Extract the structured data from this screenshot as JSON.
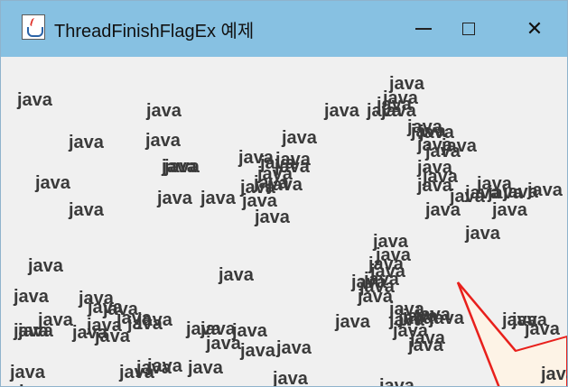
{
  "window": {
    "title": "ThreadFinishFlagEx 예제",
    "icon": "java-coffee-cup-icon",
    "controls": {
      "minimize": "minimize-icon",
      "maximize": "maximize-icon",
      "close": "close-icon"
    }
  },
  "content": {
    "word": "java",
    "labels": [
      "java",
      "java",
      "java",
      "java",
      "java",
      "java",
      "java",
      "java",
      "java",
      "java",
      "java",
      "java",
      "java",
      "java",
      "java",
      "java",
      "java",
      "java",
      "java",
      "java",
      "java",
      "java",
      "java",
      "java",
      "java",
      "java",
      "java",
      "java",
      "java",
      "java",
      "java",
      "java",
      "java",
      "java",
      "java",
      "java",
      "java",
      "java",
      "java",
      "java",
      "java",
      "java",
      "java",
      "java",
      "java",
      "java",
      "java",
      "java",
      "java",
      "java",
      "java",
      "java",
      "java",
      "java",
      "java",
      "java",
      "java",
      "java",
      "java",
      "java",
      "java",
      "java",
      "java",
      "java",
      "java",
      "java",
      "java",
      "java",
      "java",
      "java",
      "java",
      "java",
      "java",
      "java",
      "java",
      "java",
      "java",
      "java",
      "java",
      "java",
      "java",
      "java",
      "java",
      "java",
      "java",
      "java",
      "java",
      "java",
      "java",
      "java",
      "java",
      "java",
      "java",
      "java",
      "java",
      "java"
    ],
    "label_color": "#3a3a3a"
  },
  "colors": {
    "titlebar": "#87c1e2",
    "client": "#f0f0f0",
    "callout_stroke": "#e8201c",
    "callout_fill": "#fdf3e6"
  }
}
